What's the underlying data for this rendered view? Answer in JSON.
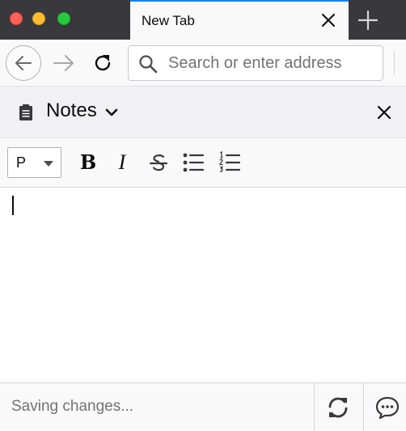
{
  "tab": {
    "title": "New Tab"
  },
  "navbar": {
    "search_placeholder": "Search or enter address"
  },
  "notes": {
    "title": "Notes"
  },
  "toolbar": {
    "paragraph_format": "P",
    "bold_label": "B",
    "italic_label": "I"
  },
  "footer": {
    "status": "Saving changes..."
  },
  "colors": {
    "tabstrip_bg": "#38383d",
    "active_tab_accent": "#0a84ff",
    "close_red": "#fe5f57",
    "minimize_yellow": "#febc2e",
    "maximize_green": "#28c840"
  },
  "icons": {
    "close": "close-icon",
    "new_tab": "plus-icon",
    "back": "back-arrow-icon",
    "forward": "forward-arrow-icon",
    "reload": "reload-icon",
    "search": "search-icon",
    "notes": "clipboard-icon",
    "dropdown": "chevron-down-icon",
    "strikethrough": "strikethrough-icon",
    "bullet_list": "bullet-list-icon",
    "numbered_list": "numbered-list-icon",
    "sync": "sync-icon",
    "feedback": "chat-bubble-icon"
  }
}
